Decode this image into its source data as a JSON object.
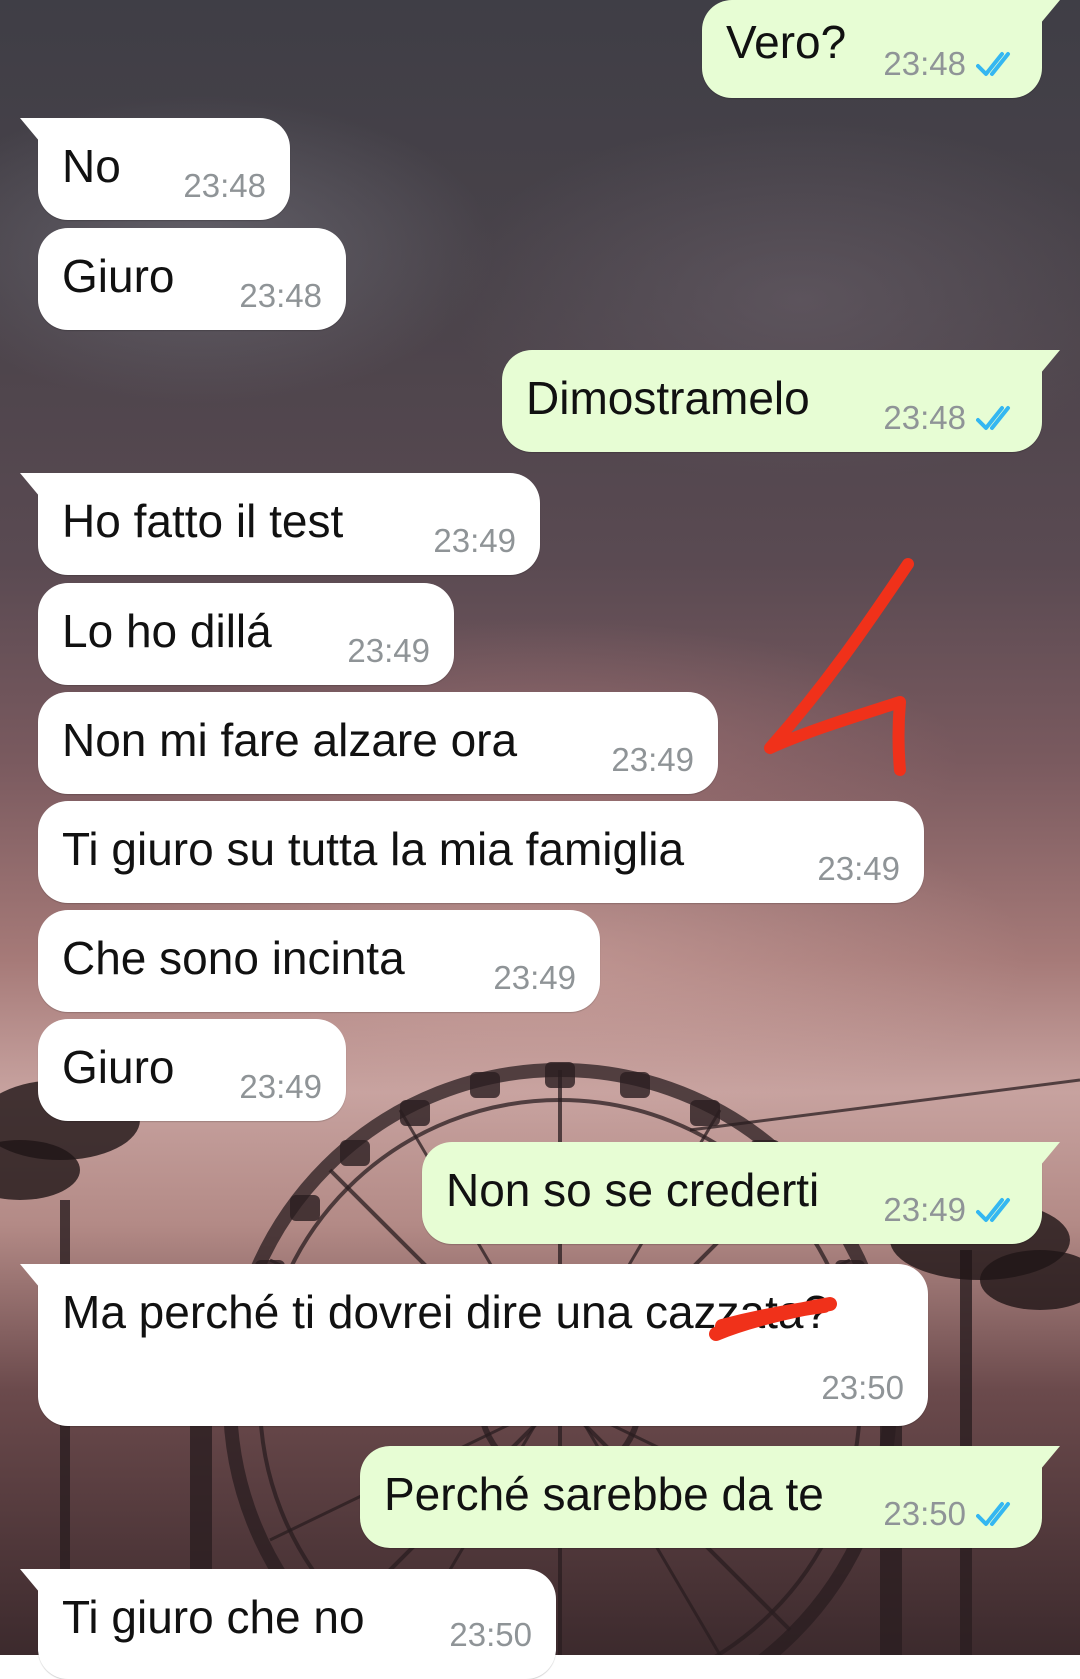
{
  "chat": {
    "messages": [
      {
        "id": "m1",
        "direction": "out",
        "text": "Vero?",
        "time": "23:48",
        "status": "read"
      },
      {
        "id": "m2",
        "direction": "in",
        "text": "No",
        "time": "23:48"
      },
      {
        "id": "m3",
        "direction": "in",
        "text": "Giuro",
        "time": "23:48"
      },
      {
        "id": "m4",
        "direction": "out",
        "text": "Dimostramelo",
        "time": "23:48",
        "status": "read"
      },
      {
        "id": "m5",
        "direction": "in",
        "text": "Ho fatto il test",
        "time": "23:49"
      },
      {
        "id": "m6",
        "direction": "in",
        "text": "Lo ho dillá",
        "time": "23:49"
      },
      {
        "id": "m7",
        "direction": "in",
        "text": "Non mi fare alzare ora",
        "time": "23:49"
      },
      {
        "id": "m8",
        "direction": "in",
        "text": "Ti giuro su tutta la mia famiglia",
        "time": "23:49"
      },
      {
        "id": "m9",
        "direction": "in",
        "text": "Che sono incinta",
        "time": "23:49"
      },
      {
        "id": "m10",
        "direction": "in",
        "text": "Giuro",
        "time": "23:49"
      },
      {
        "id": "m11",
        "direction": "out",
        "text": "Non so se crederti",
        "time": "23:49",
        "status": "read"
      },
      {
        "id": "m12",
        "direction": "in",
        "text": "Ma perché ti dovrei dire una cazzata?",
        "time": "23:50"
      },
      {
        "id": "m13",
        "direction": "out",
        "text": "Perché sarebbe da te",
        "time": "23:50",
        "status": "read"
      },
      {
        "id": "m14",
        "direction": "in",
        "text": "Ti giuro che no",
        "time": "23:50"
      }
    ]
  },
  "colors": {
    "incoming_bubble": "#ffffff",
    "outgoing_bubble": "#e7fdd4",
    "timestamp": "#8f9497",
    "read_ticks": "#34b7f1",
    "annotation_red": "#f0311a"
  },
  "icons": {
    "read_status": "double-check-icon",
    "annotation": "red-arrow-annotation",
    "censor": "red-strike-scribble"
  }
}
